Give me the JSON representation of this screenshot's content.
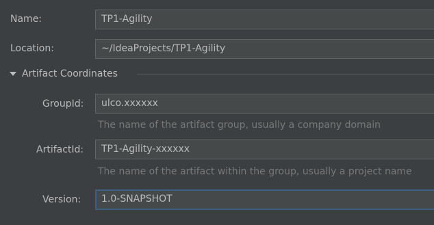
{
  "form": {
    "name": {
      "label": "Name:",
      "value": "TP1-Agility"
    },
    "location": {
      "label": "Location:",
      "value": "~/IdeaProjects/TP1-Agility"
    },
    "artifact_section": {
      "title": "Artifact Coordinates",
      "expanded": true,
      "group_id": {
        "label": "GroupId:",
        "value": "ulco.xxxxxx",
        "hint": "The name of the artifact group, usually a company domain"
      },
      "artifact_id": {
        "label": "ArtifactId:",
        "value": "TP1-Agility-xxxxxx",
        "hint": "The name of the artifact within the group, usually a project name"
      },
      "version": {
        "label": "Version:",
        "value": "1.0-SNAPSHOT"
      }
    }
  },
  "colors": {
    "background": "#3c3f41",
    "field_background": "#45494a",
    "field_border": "#646464",
    "focus_border": "#3d6185",
    "text": "#bbbbbb",
    "hint_text": "#787878"
  }
}
